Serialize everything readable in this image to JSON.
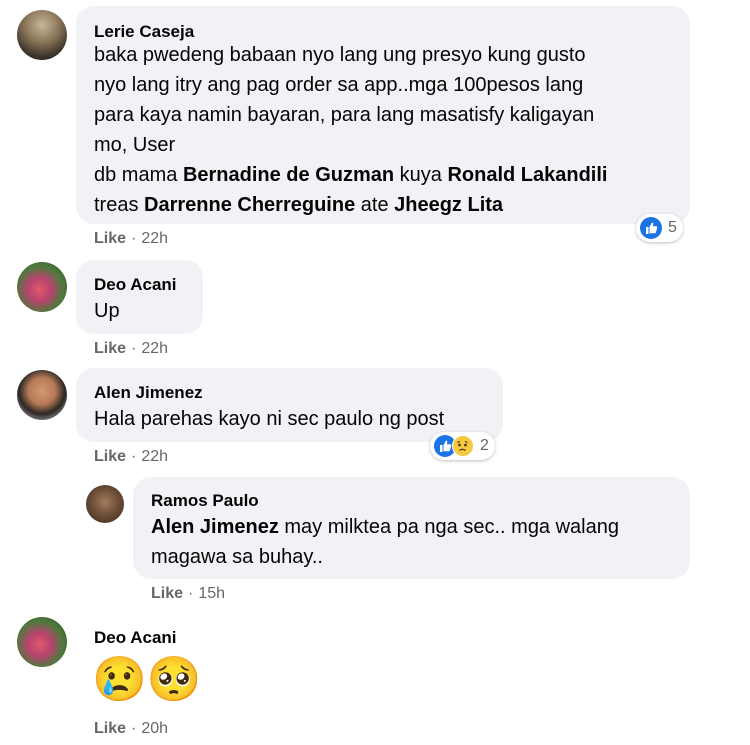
{
  "comments": [
    {
      "author": "Lerie Caseja",
      "lines": [
        "baka pwedeng babaan nyo lang ung presyo kung gusto",
        "nyo lang itry ang pag order sa app..mga 100pesos lang",
        "para kaya namin bayaran, para lang masatisfy kaligayan",
        "mo, User"
      ],
      "tag_line1": {
        "p1": "db mama ",
        "t1": "Bernadine de Guzman",
        "p2": " kuya ",
        "t2": "Ronald Lakandili"
      },
      "tag_line2": {
        "p1": "treas ",
        "t1": "Darrenne Cherreguine",
        "p2": " ate ",
        "t2": "Jheegz Lita"
      },
      "like": "Like",
      "time": "22h",
      "reaction_count": "5"
    },
    {
      "author": "Deo Acani",
      "text": "Up",
      "like": "Like",
      "time": "22h"
    },
    {
      "author": "Alen Jimenez",
      "text": "Hala parehas kayo ni sec paulo ng post",
      "like": "Like",
      "time": "22h",
      "reaction_count": "2"
    },
    {
      "author": "Ramos Paulo",
      "mention": "Alen Jimenez",
      "text_line1": " may milktea pa nga sec.. mga walang",
      "text_line2": "magawa sa buhay..",
      "like": "Like",
      "time": "15h"
    },
    {
      "author": "Deo Acani",
      "emojis": "😢🥺",
      "like": "Like",
      "time": "20h"
    }
  ],
  "dot": "·",
  "icons": {
    "like": "like-reaction-icon",
    "sad": "sad-reaction-icon"
  },
  "colors": {
    "bubble": "#f0f2f5",
    "meta": "#65676b",
    "like_blue": "#1b74e4"
  }
}
